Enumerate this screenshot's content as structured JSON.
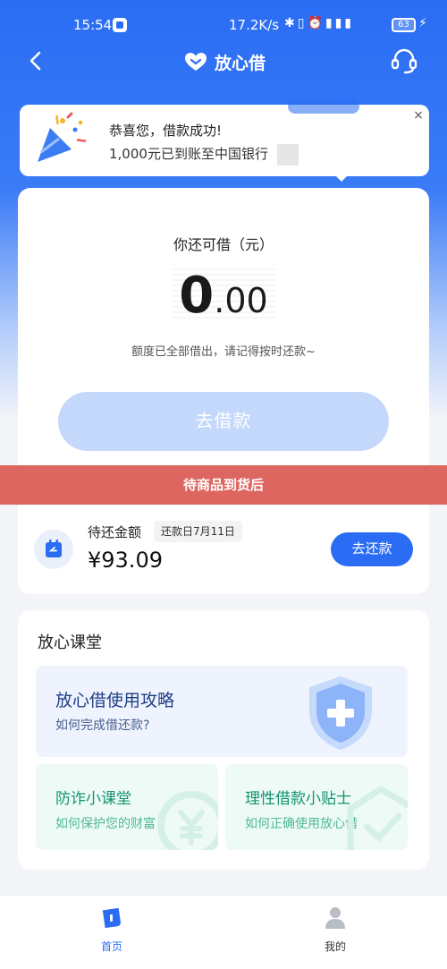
{
  "status_bar": {
    "time": "15:54",
    "network_speed": "17.2K/s",
    "icons": [
      "bluetooth-icon",
      "vibrate-icon",
      "alarm-icon",
      "signal-icon"
    ],
    "battery": "63"
  },
  "nav": {
    "brand_name": "放心借",
    "brand_color": "#2a6df4"
  },
  "toast": {
    "title": "恭喜您，借款成功!",
    "detail": "1,000元已到账至中国银行",
    "close": "×"
  },
  "credit": {
    "label": "你还可借（元）",
    "amount_int": "0",
    "amount_dec": ".00",
    "hint": "额度已全部借出，请记得按时还款~",
    "borrow_button": "去借款"
  },
  "banner": {
    "text": "待商品到货后",
    "color": "#de6660"
  },
  "repay": {
    "title": "待还金额",
    "due_date": "还款日7月11日",
    "amount": "¥93.09",
    "button": "去还款"
  },
  "classroom": {
    "heading": "放心课堂",
    "guide": {
      "title": "放心借使用攻略",
      "subtitle": "如何完成借还款?"
    },
    "tiles": [
      {
        "title": "防诈小课堂",
        "subtitle": "如何保护您的财富"
      },
      {
        "title": "理性借款小贴士",
        "subtitle": "如何正确使用放心借"
      }
    ]
  },
  "bottom_nav": {
    "items": [
      {
        "label": "首页",
        "icon": "home-icon",
        "active": true
      },
      {
        "label": "我的",
        "icon": "profile-icon",
        "active": false
      }
    ]
  }
}
